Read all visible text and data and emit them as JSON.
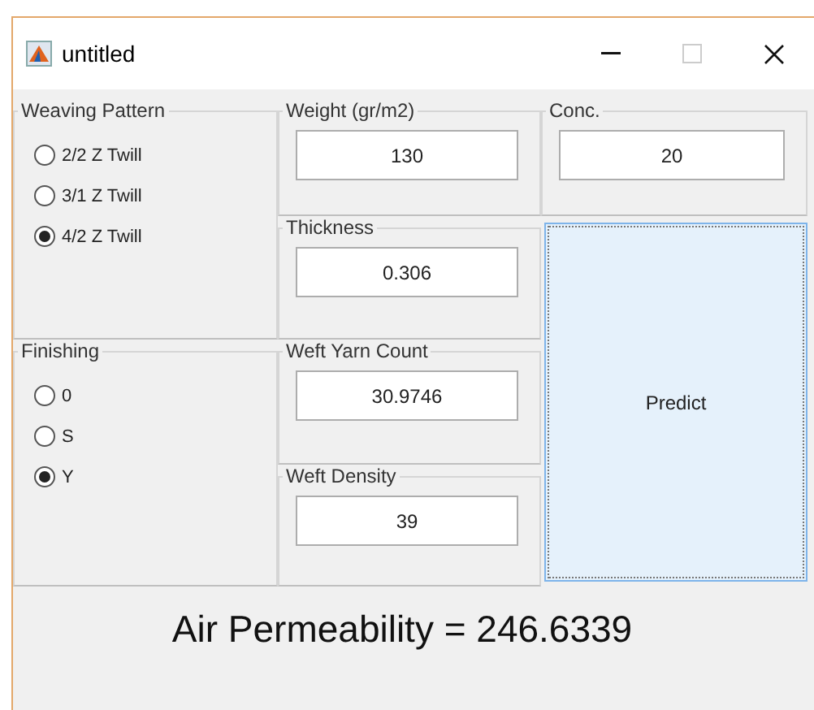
{
  "window": {
    "title": "untitled"
  },
  "weaving_pattern": {
    "title": "Weaving Pattern",
    "options": [
      {
        "label": "2/2 Z Twill",
        "selected": false
      },
      {
        "label": "3/1 Z Twill",
        "selected": false
      },
      {
        "label": "4/2 Z Twill",
        "selected": true
      }
    ]
  },
  "finishing": {
    "title": "Finishing",
    "options": [
      {
        "label": "0",
        "selected": false
      },
      {
        "label": "S",
        "selected": false
      },
      {
        "label": "Y",
        "selected": true
      }
    ]
  },
  "fields": [
    {
      "title": "Weight (gr/m2)",
      "value": "130"
    },
    {
      "title": "Thickness",
      "value": "0.306"
    },
    {
      "title": "Weft Yarn Count",
      "value": "30.9746"
    },
    {
      "title": "Weft Density",
      "value": "39"
    }
  ],
  "conc": {
    "title": "Conc.",
    "value": "20"
  },
  "predict_button": {
    "label": "Predict"
  },
  "result": "Air Permeability = 246.6339"
}
